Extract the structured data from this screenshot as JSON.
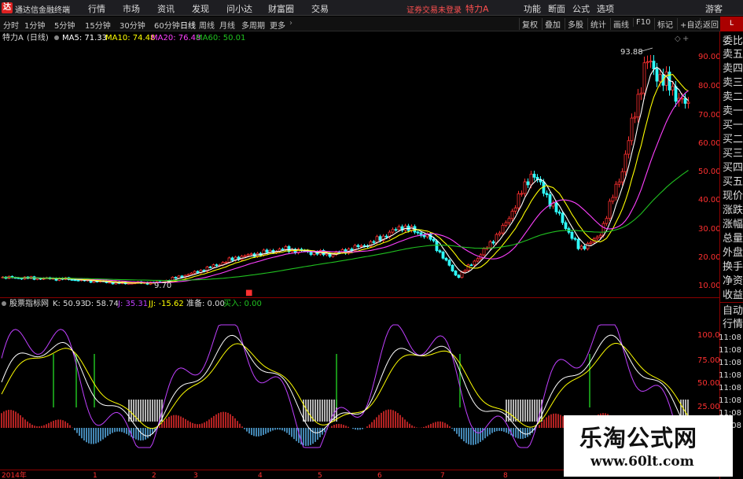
{
  "titlebar": {
    "app_title": "通达信金融终端",
    "menus": [
      "行情",
      "市场",
      "资讯",
      "发现",
      "问小达",
      "财富圈",
      "交易"
    ],
    "login_status": "证券交易未登录",
    "stock_name": "特力A",
    "right_buttons": [
      "功能",
      "断面",
      "公式",
      "选项",
      "游客"
    ]
  },
  "toolbar": {
    "periods": [
      "分时",
      "1分钟",
      "5分钟",
      "15分钟",
      "30分钟",
      "60分钟",
      "日线",
      "周线",
      "月线",
      "多周期",
      "更多"
    ],
    "active_period": "日线",
    "right_buttons": [
      "复权",
      "叠加",
      "多股",
      "统计",
      "画线",
      "F10",
      "标记",
      "+自选",
      "返回"
    ]
  },
  "price_panel": {
    "header_name": "特力A",
    "header_period": "(日线)",
    "ma5": "MA5: 71.33",
    "ma10": "MA10: 74.48",
    "ma20": "MA20: 76.48",
    "ma60": "MA60: 50.01",
    "high_label": "93.88",
    "low_label": "9.70",
    "y_ticks": [
      "90.00",
      "80.00",
      "70.00",
      "60.00",
      "50.00",
      "40.00",
      "30.00",
      "20.00",
      "10.00"
    ],
    "colors": {
      "up": "#ff3030",
      "down": "#30ffff",
      "ma5": "#ffffff",
      "ma10": "#ffff00",
      "ma20": "#ff40ff",
      "ma60": "#20c020"
    }
  },
  "indicator_panel": {
    "name": "股票指标网",
    "k": "K: 50.93",
    "d": "D: 58.74",
    "j": "J: 35.31",
    "jj": "JJ: -15.62",
    "zb": "准备: 0.00",
    "buy": "买入: 0.00",
    "y_ticks": [
      "100.0",
      "75.00",
      "50.00",
      "25.00"
    ]
  },
  "xaxis": {
    "labels": [
      "2014年",
      "1",
      "2",
      "3",
      "4",
      "5",
      "6",
      "7",
      "8"
    ]
  },
  "right_panel": {
    "top": "L",
    "items": [
      "委比",
      "卖五",
      "卖四",
      "卖三",
      "卖二",
      "卖一",
      "买一",
      "买二",
      "买三",
      "买四",
      "买五",
      "现价",
      "涨跌",
      "涨幅",
      "总量",
      "外盘",
      "换手",
      "净资",
      "收益"
    ],
    "items2": [
      "自动",
      "行情"
    ],
    "times": [
      "11:08",
      "11:08",
      "11:08",
      "11:08",
      "11:08",
      "11:08",
      "11:08",
      "11:08"
    ]
  },
  "watermark": {
    "cn": "乐淘公式网",
    "url": "www.60lt.com"
  }
}
